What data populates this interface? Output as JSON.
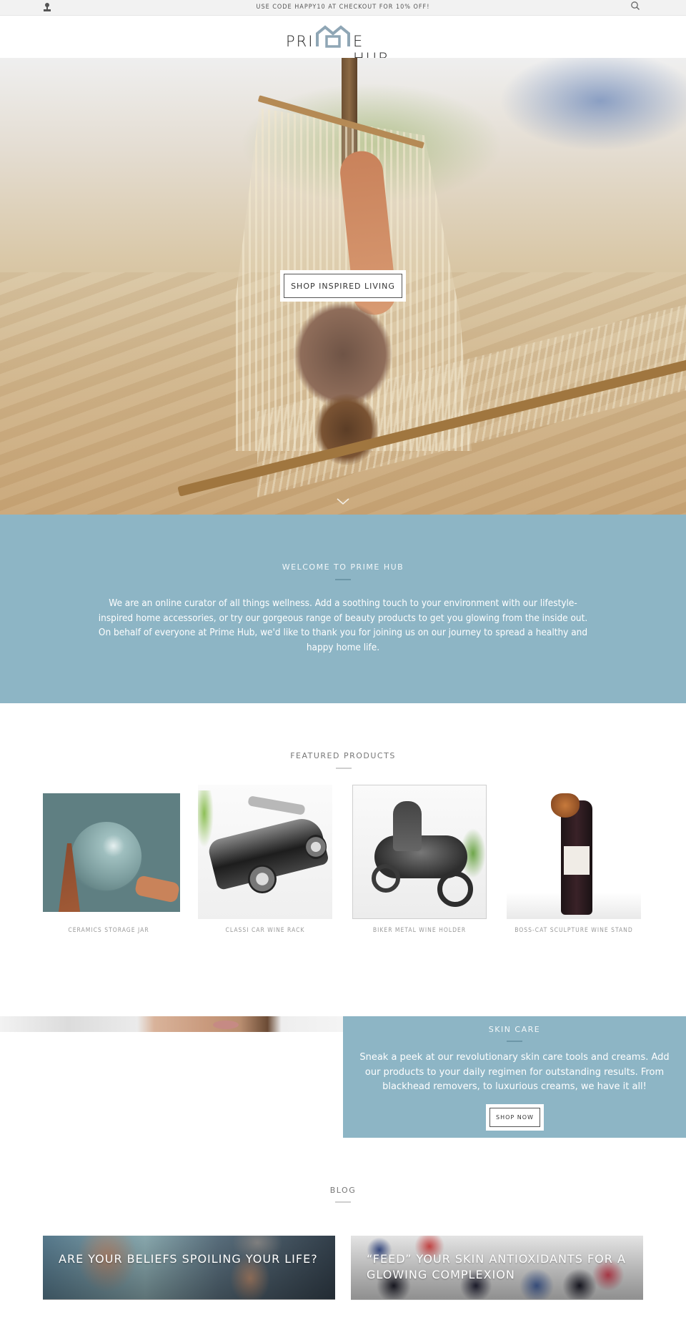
{
  "announcement": {
    "text": "USE CODE HAPPY10 AT CHECKOUT FOR 10% OFF!",
    "account_icon": "user-icon",
    "search_icon": "search-icon"
  },
  "header": {
    "logo_left": "PRI",
    "logo_right": "E HUB",
    "logo_icon": "house-icon",
    "brand_color": "#8fa6b5"
  },
  "hero": {
    "cta_label": "SHOP INSPIRED LIVING",
    "scroll_icon": "chevron-down-icon"
  },
  "welcome": {
    "heading": "WELCOME TO PRIME HUB",
    "body": "We are an online curator of all things wellness. Add a soothing touch to your environment with our lifestyle-inspired home accessories, or try our gorgeous range of beauty products to get you glowing from the inside out. On behalf of everyone at Prime Hub, we'd like to thank you for joining us on our journey to spread a healthy and happy home life.",
    "background_color": "#8db5c5"
  },
  "featured": {
    "heading": "FEATURED PRODUCTS",
    "products": [
      {
        "name": "CERAMICS STORAGE JAR"
      },
      {
        "name": "CLASSI CAR WINE RACK"
      },
      {
        "name": "BIKER METAL WINE HOLDER"
      },
      {
        "name": "BOSS-CAT SCULPTURE WINE STAND"
      }
    ]
  },
  "skin_care": {
    "heading": "SKIN CARE",
    "body": "Sneak a peek at our revolutionary skin care tools and creams. Add our products to your daily regimen for outstanding results. From blackhead removers, to luxurious creams, we have it all!",
    "cta_label": "SHOP NOW"
  },
  "blog": {
    "heading": "BLOG",
    "posts": [
      {
        "title": "ARE YOUR BELIEFS SPOILING YOUR LIFE?"
      },
      {
        "title": "“FEED” YOUR SKIN ANTIOXIDANTS FOR A GLOWING COMPLEXION"
      }
    ]
  }
}
